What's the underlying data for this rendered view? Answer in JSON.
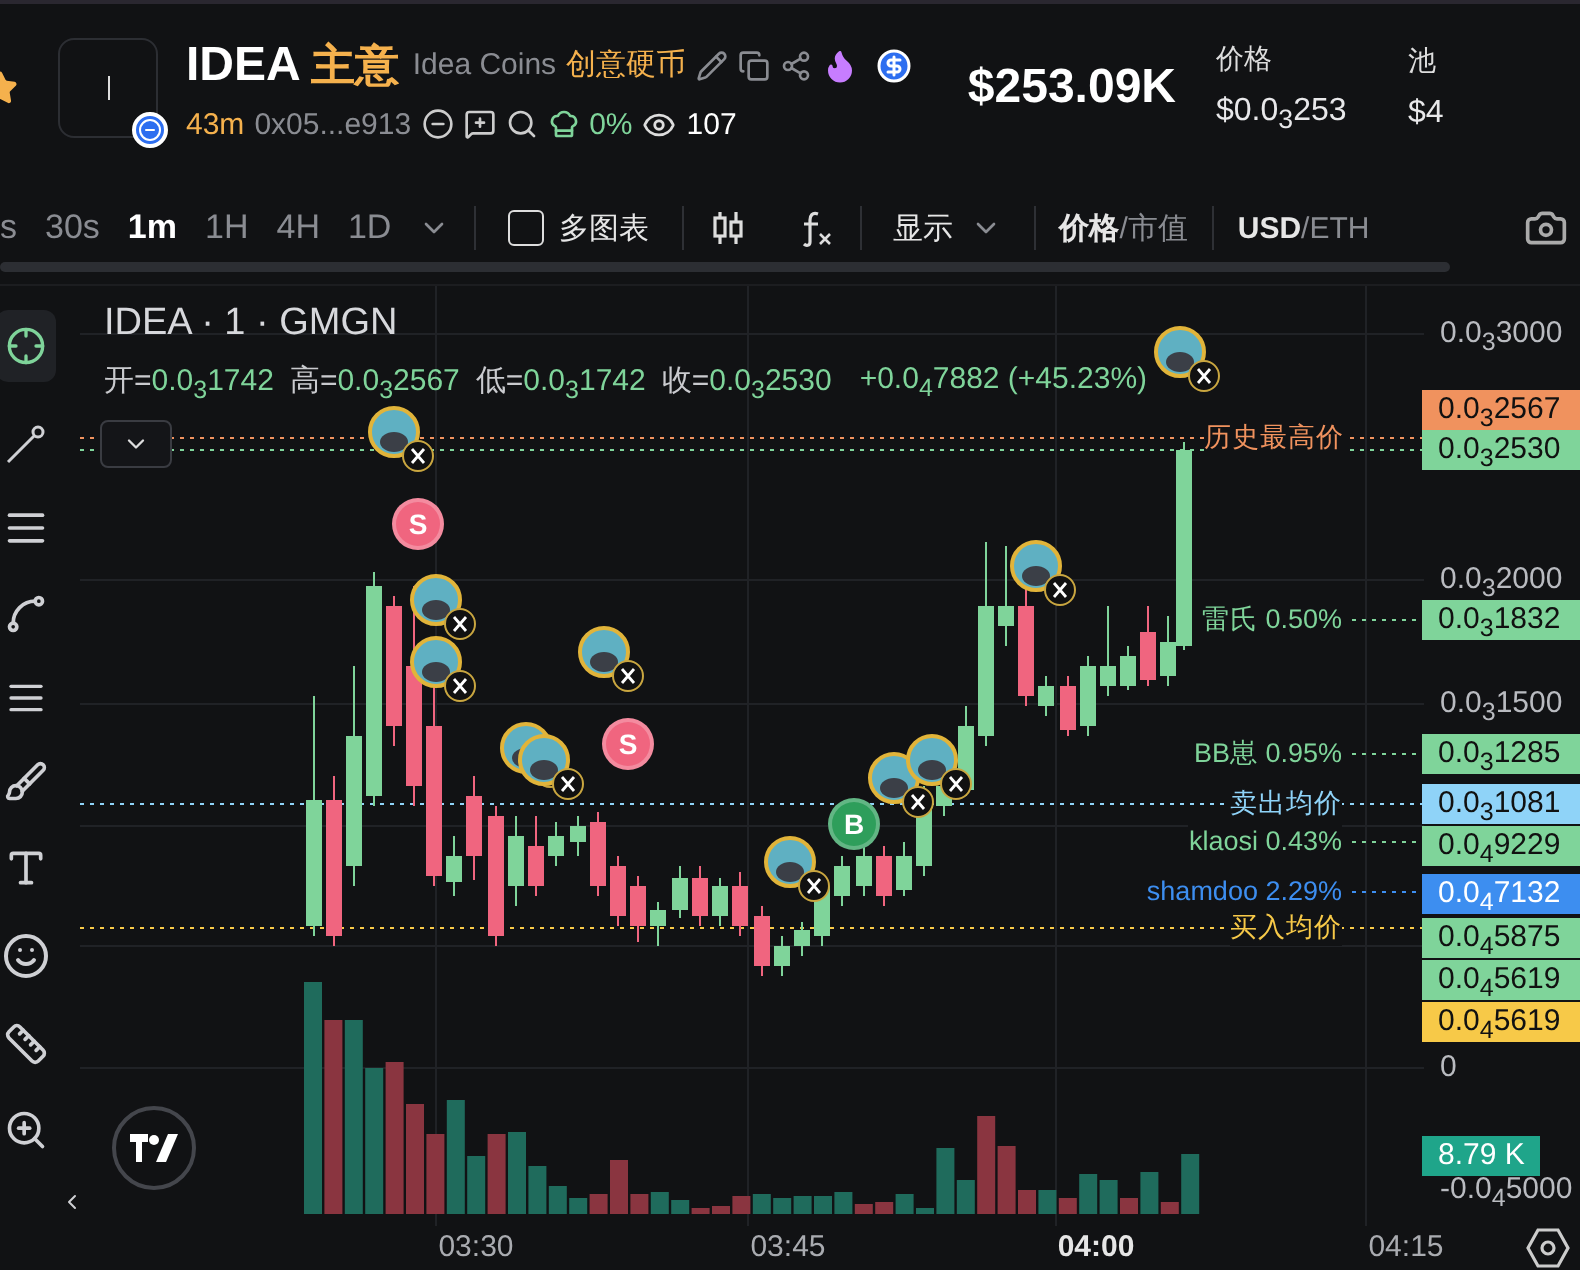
{
  "header": {
    "symbol": "IDEA",
    "symbol_cn": "主意",
    "name": "Idea Coins",
    "name_cn": "创意硬币",
    "age": "43m",
    "address": "0x05...e913",
    "holder_share": "0%",
    "views": "107",
    "market_cap": "$253.09K",
    "stats": [
      {
        "label": "价格",
        "value": "$0.0$_{3}$253"
      },
      {
        "label": "池",
        "value": "$4"
      }
    ]
  },
  "intervals": [
    {
      "label": "s",
      "selected": false
    },
    {
      "label": "30s",
      "selected": false
    },
    {
      "label": "1m",
      "selected": true
    },
    {
      "label": "1H",
      "selected": false
    },
    {
      "label": "4H",
      "selected": false
    },
    {
      "label": "1D",
      "selected": false
    }
  ],
  "toolbar": {
    "multi_chart": {
      "label": "多图表",
      "checked": false
    },
    "display": "显示",
    "separator": "/",
    "value_mode": [
      {
        "label": "价格",
        "selected": true
      },
      {
        "label": "市值",
        "selected": false
      }
    ],
    "currency": [
      {
        "label": "USD",
        "selected": true
      },
      {
        "label": "ETH",
        "selected": false
      }
    ]
  },
  "chart": {
    "title": "IDEA · 1 · GMGN",
    "ohlc": [
      {
        "label": "开=",
        "value": "0.0$_{3}$1742"
      },
      {
        "label": "高=",
        "value": "0.0$_{3}$2567"
      },
      {
        "label": "低=",
        "value": "0.0$_{3}$1742"
      },
      {
        "label": "收=",
        "value": "0.0$_{3}$2530"
      }
    ],
    "change": "+0.0$_{4}$7882 (+45.23%)",
    "price_ticks": [
      "0.0$_{3}$3000",
      "0.0$_{3}$2000",
      "0.0$_{3}$1500",
      "0",
      "-0.0$_{4}$5000"
    ],
    "tags": [
      {
        "value": "0.0$_{3}$2567",
        "color": "#f0925e"
      },
      {
        "value": "0.0$_{3}$2530",
        "color": "#7fd49a"
      },
      {
        "value": "0.0$_{3}$1832",
        "color": "#7fd49a"
      },
      {
        "value": "0.0$_{3}$1285",
        "color": "#7fd49a"
      },
      {
        "value": "0.0$_{3}$1081",
        "color": "#8fd3f8"
      },
      {
        "value": "0.0$_{4}$9229",
        "color": "#7fd49a"
      },
      {
        "value": "0.0$_{4}$7132",
        "color": "#3d8ef0"
      },
      {
        "value": "0.0$_{4}$5875",
        "color": "#7fd49a"
      },
      {
        "value": "0.0$_{4}$5619",
        "color": "#7fd49a"
      },
      {
        "value": "0.0$_{4}$5619",
        "color": "#f7c948"
      },
      {
        "value": "8.79 K",
        "color": "#1fa58a"
      }
    ],
    "lines": [
      {
        "kind": "level",
        "label": "历史最高价",
        "color": "#f0925e"
      },
      {
        "kind": "holder",
        "label": "雷氏 0.50%",
        "color": "#7fd49a"
      },
      {
        "kind": "holder",
        "label": "BB崽 0.95%",
        "color": "#7fd49a"
      },
      {
        "kind": "level",
        "label": "卖出均价",
        "color": "#8fd3f8"
      },
      {
        "kind": "holder",
        "label": "klaosi 0.43%",
        "color": "#7fd49a"
      },
      {
        "kind": "holder",
        "label": "shamdoo 2.29%",
        "color": "#3d8ef0"
      },
      {
        "kind": "level",
        "label": "买入均价",
        "color": "#f7c948"
      }
    ],
    "markers": [
      {
        "kind": "avatar"
      },
      {
        "kind": "sell",
        "label": "S"
      },
      {
        "kind": "avatar"
      },
      {
        "kind": "avatar"
      },
      {
        "kind": "avatar"
      },
      {
        "kind": "avatar"
      },
      {
        "kind": "avatar"
      },
      {
        "kind": "sell",
        "label": "S"
      },
      {
        "kind": "avatar"
      },
      {
        "kind": "buy",
        "label": "B"
      },
      {
        "kind": "avatar"
      },
      {
        "kind": "avatar"
      },
      {
        "kind": "avatar"
      },
      {
        "kind": "avatar"
      }
    ],
    "time_ticks": [
      {
        "label": "03:30",
        "bold": false
      },
      {
        "label": "03:45",
        "bold": false
      },
      {
        "label": "04:00",
        "bold": true
      },
      {
        "label": "04:15",
        "bold": false
      }
    ]
  }
}
